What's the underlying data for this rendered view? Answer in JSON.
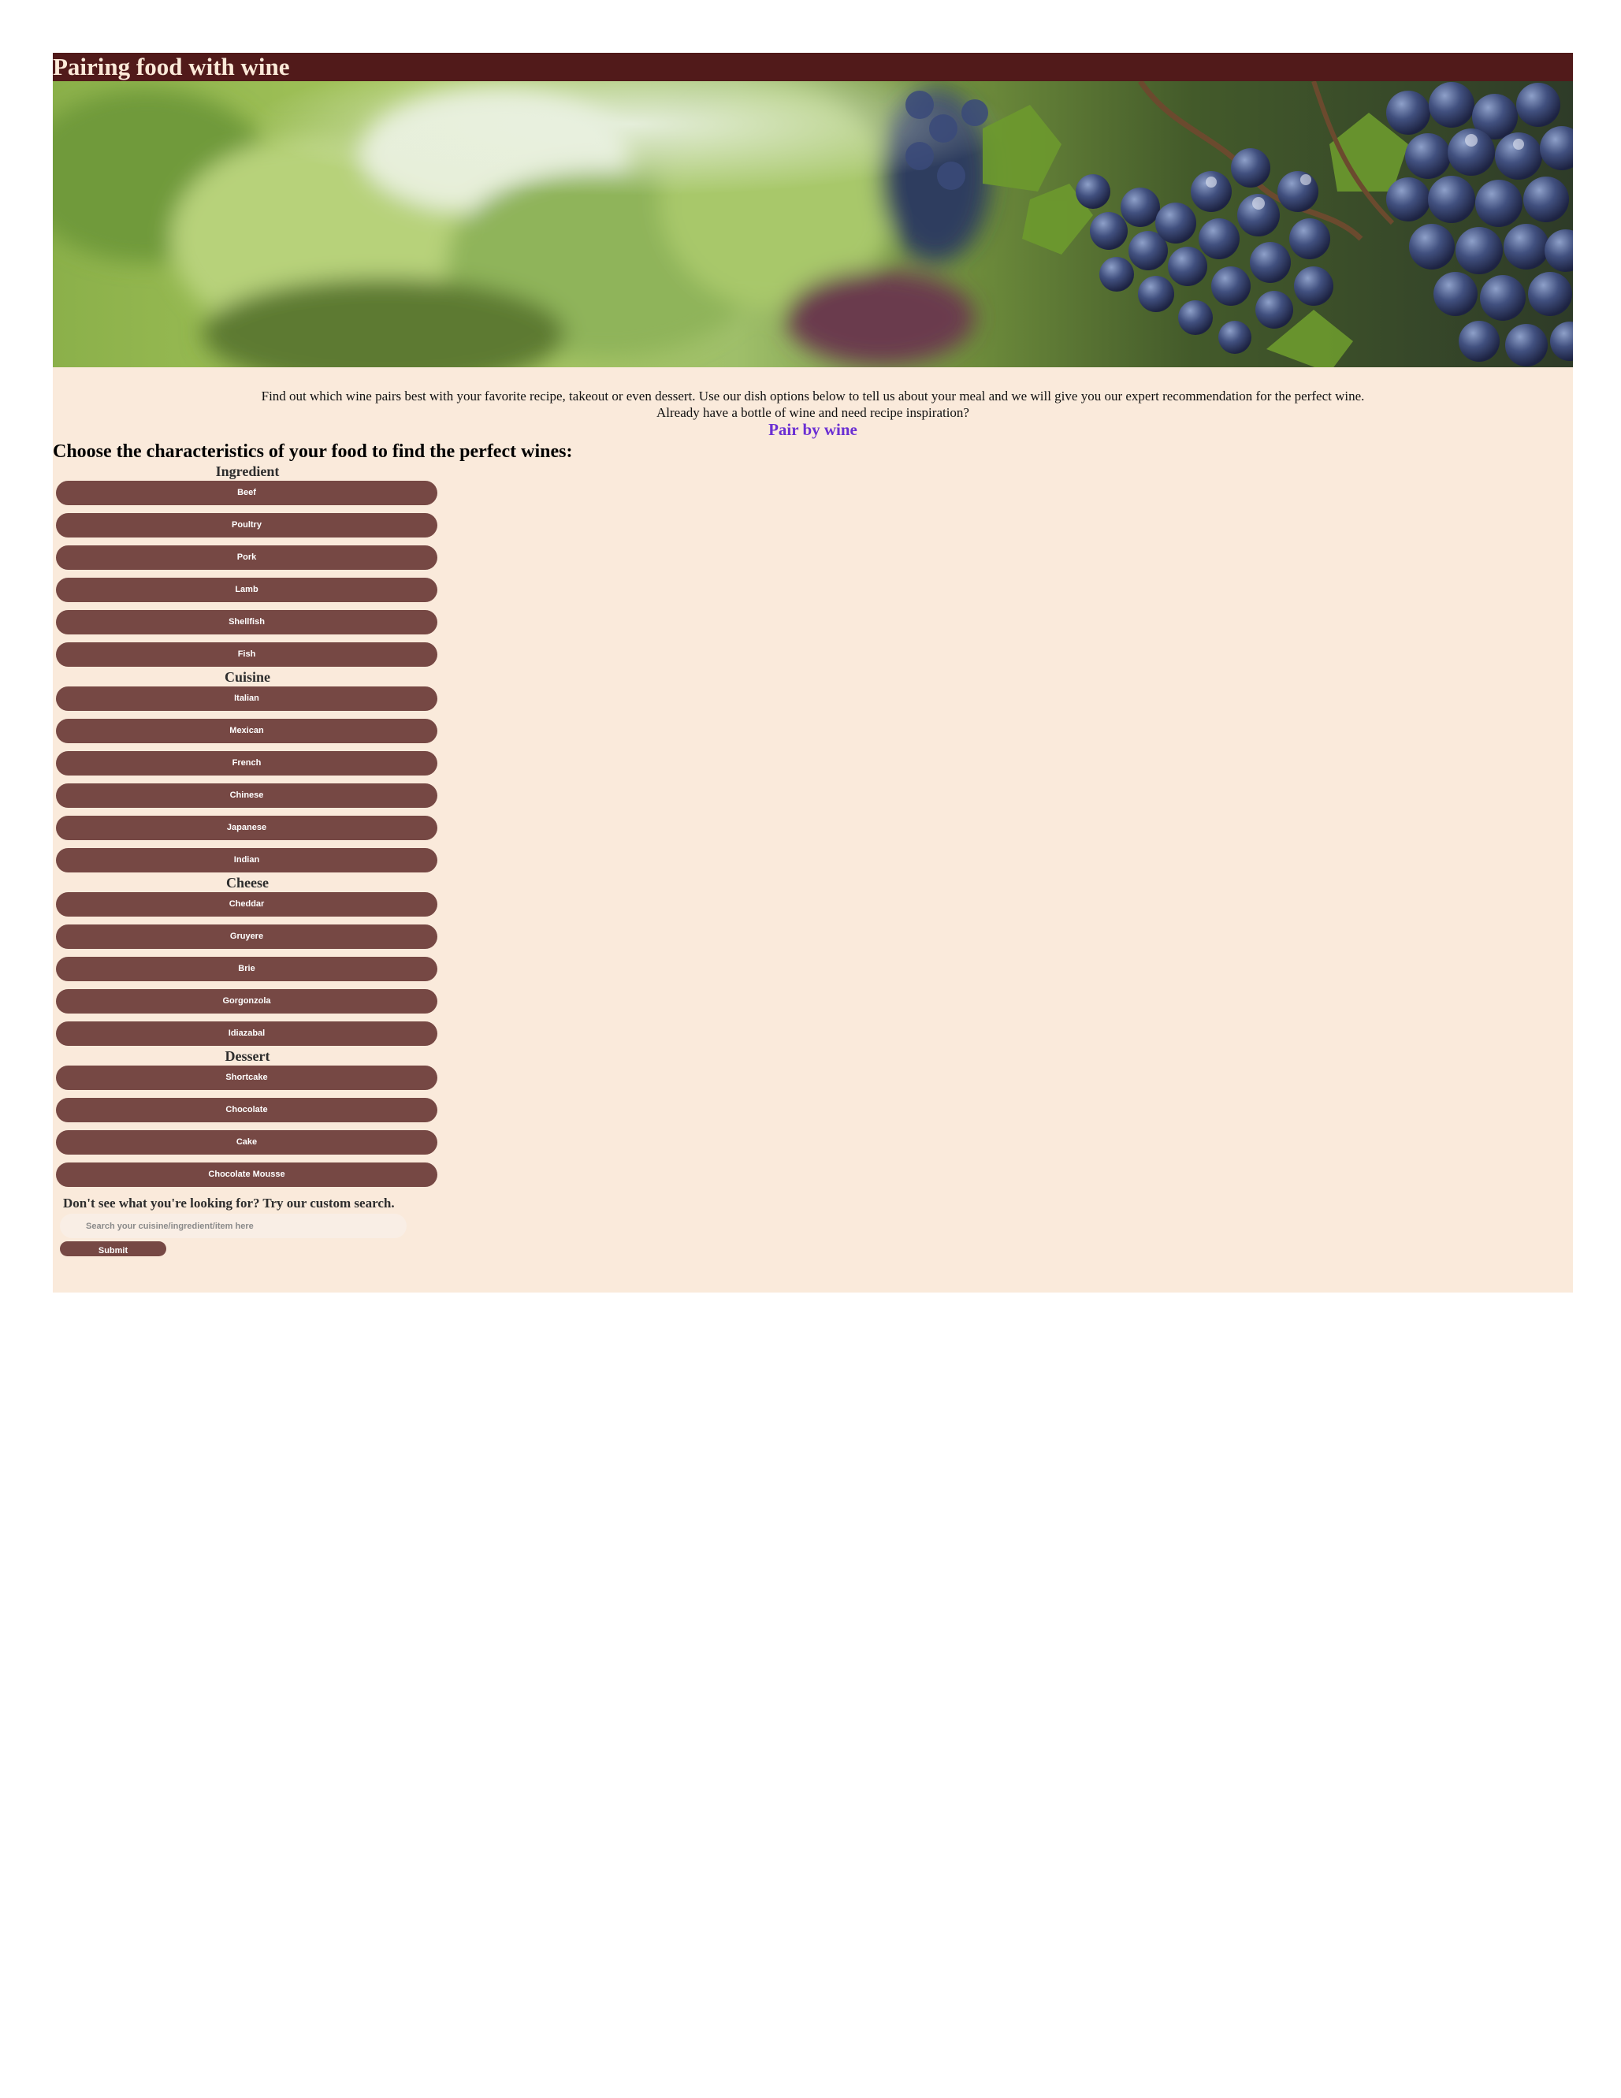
{
  "header": {
    "title": "Pairing food with wine"
  },
  "hero": {
    "image": "vineyard-grapes-image"
  },
  "intro": {
    "line1": "Find out which wine pairs best with your favorite recipe, takeout or even dessert. Use our dish options below to tell us about your meal and we will give you our expert recommendation for the perfect wine.",
    "line2": "Already have a bottle of wine and need recipe inspiration?",
    "pair_link": "Pair by wine"
  },
  "main": {
    "heading": "Choose the characteristics of your food to find the perfect wines:",
    "categories": [
      {
        "label": "Ingredient",
        "options": [
          "Beef",
          "Poultry",
          "Pork",
          "Lamb",
          "Shellfish",
          "Fish"
        ]
      },
      {
        "label": "Cuisine",
        "options": [
          "Italian",
          "Mexican",
          "French",
          "Chinese",
          "Japanese",
          "Indian"
        ]
      },
      {
        "label": "Cheese",
        "options": [
          "Cheddar",
          "Gruyere",
          "Brie",
          "Gorgonzola",
          "Idiazabal"
        ]
      },
      {
        "label": "Dessert",
        "options": [
          "Shortcake",
          "Chocolate",
          "Cake",
          "Chocolate Mousse"
        ]
      }
    ]
  },
  "custom_search": {
    "heading": "Don't see what you're looking for? Try our custom search.",
    "placeholder": "Search your cuisine/ingredient/item here",
    "submit_label": "Submit"
  },
  "colors": {
    "title_bar": "#511a1a",
    "title_text": "#fbe9d8",
    "content_bg": "#faeadb",
    "button_bg": "#764844",
    "link": "#6b2fd3"
  }
}
